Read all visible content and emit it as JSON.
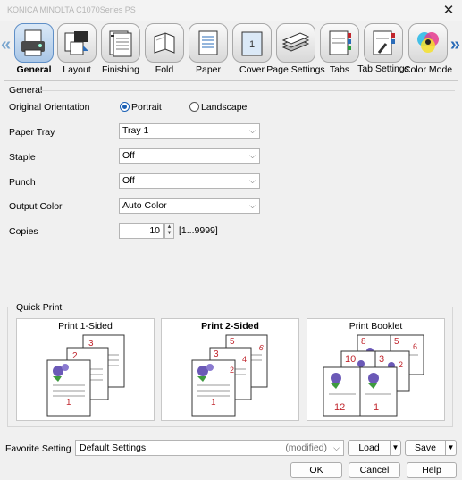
{
  "window": {
    "title": "KONICA MINOLTA C1070Series PS",
    "close_symbol": "✕"
  },
  "tabs": [
    {
      "label": "General",
      "icon": "general-icon",
      "active": true
    },
    {
      "label": "Layout",
      "icon": "layout-icon",
      "active": false
    },
    {
      "label": "Finishing",
      "icon": "finishing-icon",
      "active": false
    },
    {
      "label": "Fold",
      "icon": "fold-icon",
      "active": false
    },
    {
      "label": "Paper",
      "icon": "paper-icon",
      "active": false
    },
    {
      "label": "Cover",
      "icon": "cover-icon",
      "active": false
    },
    {
      "label": "Page Settings",
      "icon": "page-settings-icon",
      "active": false
    },
    {
      "label": "Tabs",
      "icon": "tabs-icon",
      "active": false
    },
    {
      "label": "Tab Settings",
      "icon": "tab-settings-icon",
      "active": false
    },
    {
      "label": "Color Mode",
      "icon": "color-mode-icon",
      "active": false
    }
  ],
  "cover_page_number": "1",
  "nav": {
    "left_arrow": "«",
    "right_arrow": "»"
  },
  "general": {
    "group_label": "General",
    "orientation": {
      "label": "Original Orientation",
      "portrait": "Portrait",
      "landscape": "Landscape",
      "selected": "Portrait"
    },
    "paper_tray": {
      "label": "Paper Tray",
      "value": "Tray 1"
    },
    "staple": {
      "label": "Staple",
      "value": "Off"
    },
    "punch": {
      "label": "Punch",
      "value": "Off"
    },
    "output_color": {
      "label": "Output Color",
      "value": "Auto Color"
    },
    "copies": {
      "label": "Copies",
      "value": "10",
      "range": "[1...9999]"
    }
  },
  "quick_print": {
    "label": "Quick Print",
    "options": [
      {
        "label": "Print 1-Sided",
        "bold": false,
        "pages": [
          "1",
          "2",
          "3"
        ]
      },
      {
        "label": "Print 2-Sided",
        "bold": true,
        "pages": [
          "1",
          "2",
          "3",
          "4",
          "5",
          "6"
        ]
      },
      {
        "label": "Print Booklet",
        "bold": false,
        "pages": [
          "12",
          "1",
          "10",
          "3",
          "8",
          "5",
          "2",
          "6"
        ]
      }
    ]
  },
  "favorite": {
    "label": "Favorite Setting",
    "value": "Default Settings",
    "status": "(modified)",
    "load": "Load",
    "save": "Save"
  },
  "buttons": {
    "ok": "OK",
    "cancel": "Cancel",
    "help": "Help"
  },
  "colors": {
    "accent": "#1a5fb4",
    "page_number": "#c0262d",
    "tab_active": "#a9c6e6"
  }
}
